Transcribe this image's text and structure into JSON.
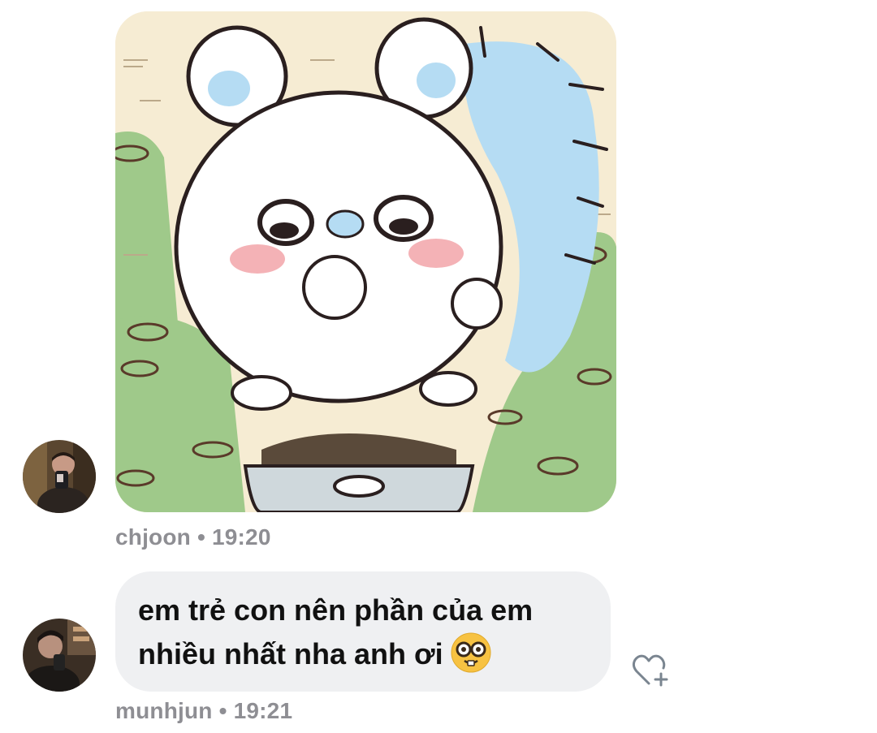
{
  "thread": {
    "messages": [
      {
        "kind": "image",
        "sender": "chjoon",
        "time": "19:20",
        "separator": "•",
        "image": "cartoon white squirrel eating"
      },
      {
        "kind": "text",
        "sender": "munhjun",
        "time": "19:21",
        "separator": "•",
        "text_line1": "em trẻ con nên phần của em",
        "text_line2": "nhiều nhất nha anh ơi",
        "emoji_icon": "nerd-face-icon"
      }
    ],
    "react_icon": "heart-plus-icon"
  },
  "colors": {
    "bubble_bg": "#eff0f2",
    "meta_text": "#8e8e93",
    "message_text": "#111111",
    "react_icon": "#7a8590"
  }
}
